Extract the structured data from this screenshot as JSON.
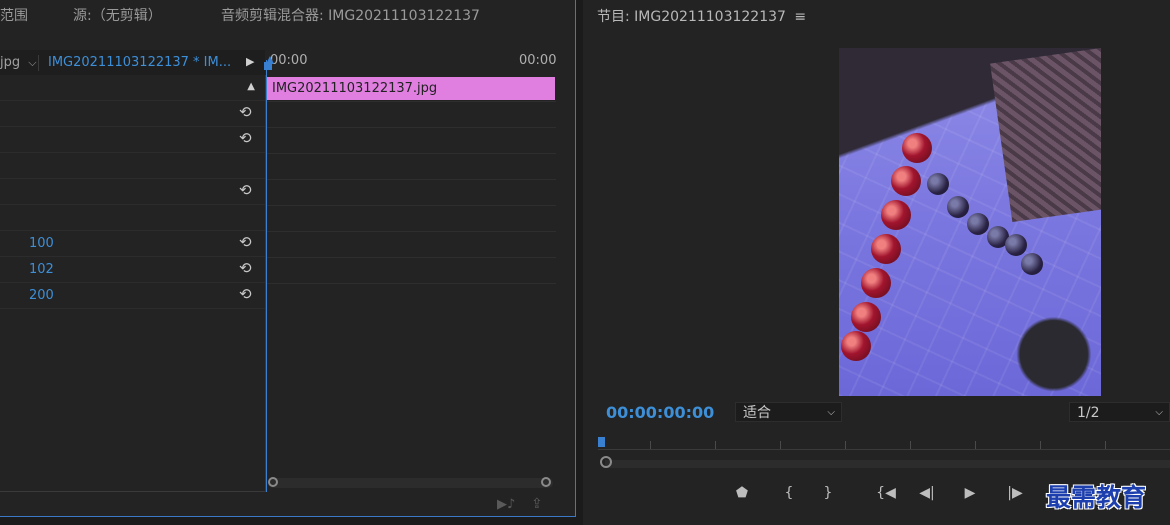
{
  "left_panel": {
    "tab_effect_controls_partial": "范围",
    "tab_source": "源:（无剪辑）",
    "tab_audio_mixer": "音频剪辑混合器: IMG20211103122137",
    "subtab_master": "jpg",
    "subtab_sequence": "IMG20211103122137 * IM...",
    "timeline_time_start": "00:00",
    "timeline_time_end": "00:00",
    "clip_name": "IMG20211103122137.jpg",
    "values": {
      "position_x": "100",
      "scale": "102",
      "anchor": "200"
    }
  },
  "right_panel": {
    "title": "节目: IMG20211103122137",
    "menu_icon": "≡",
    "timecode": "00:00:00:00",
    "fit_select": "适合",
    "resolution_select": "1/2"
  },
  "watermark": "最需教育",
  "colors": {
    "accent": "#3d8fd8",
    "clip": "#e07fe0",
    "panel": "#232323"
  }
}
